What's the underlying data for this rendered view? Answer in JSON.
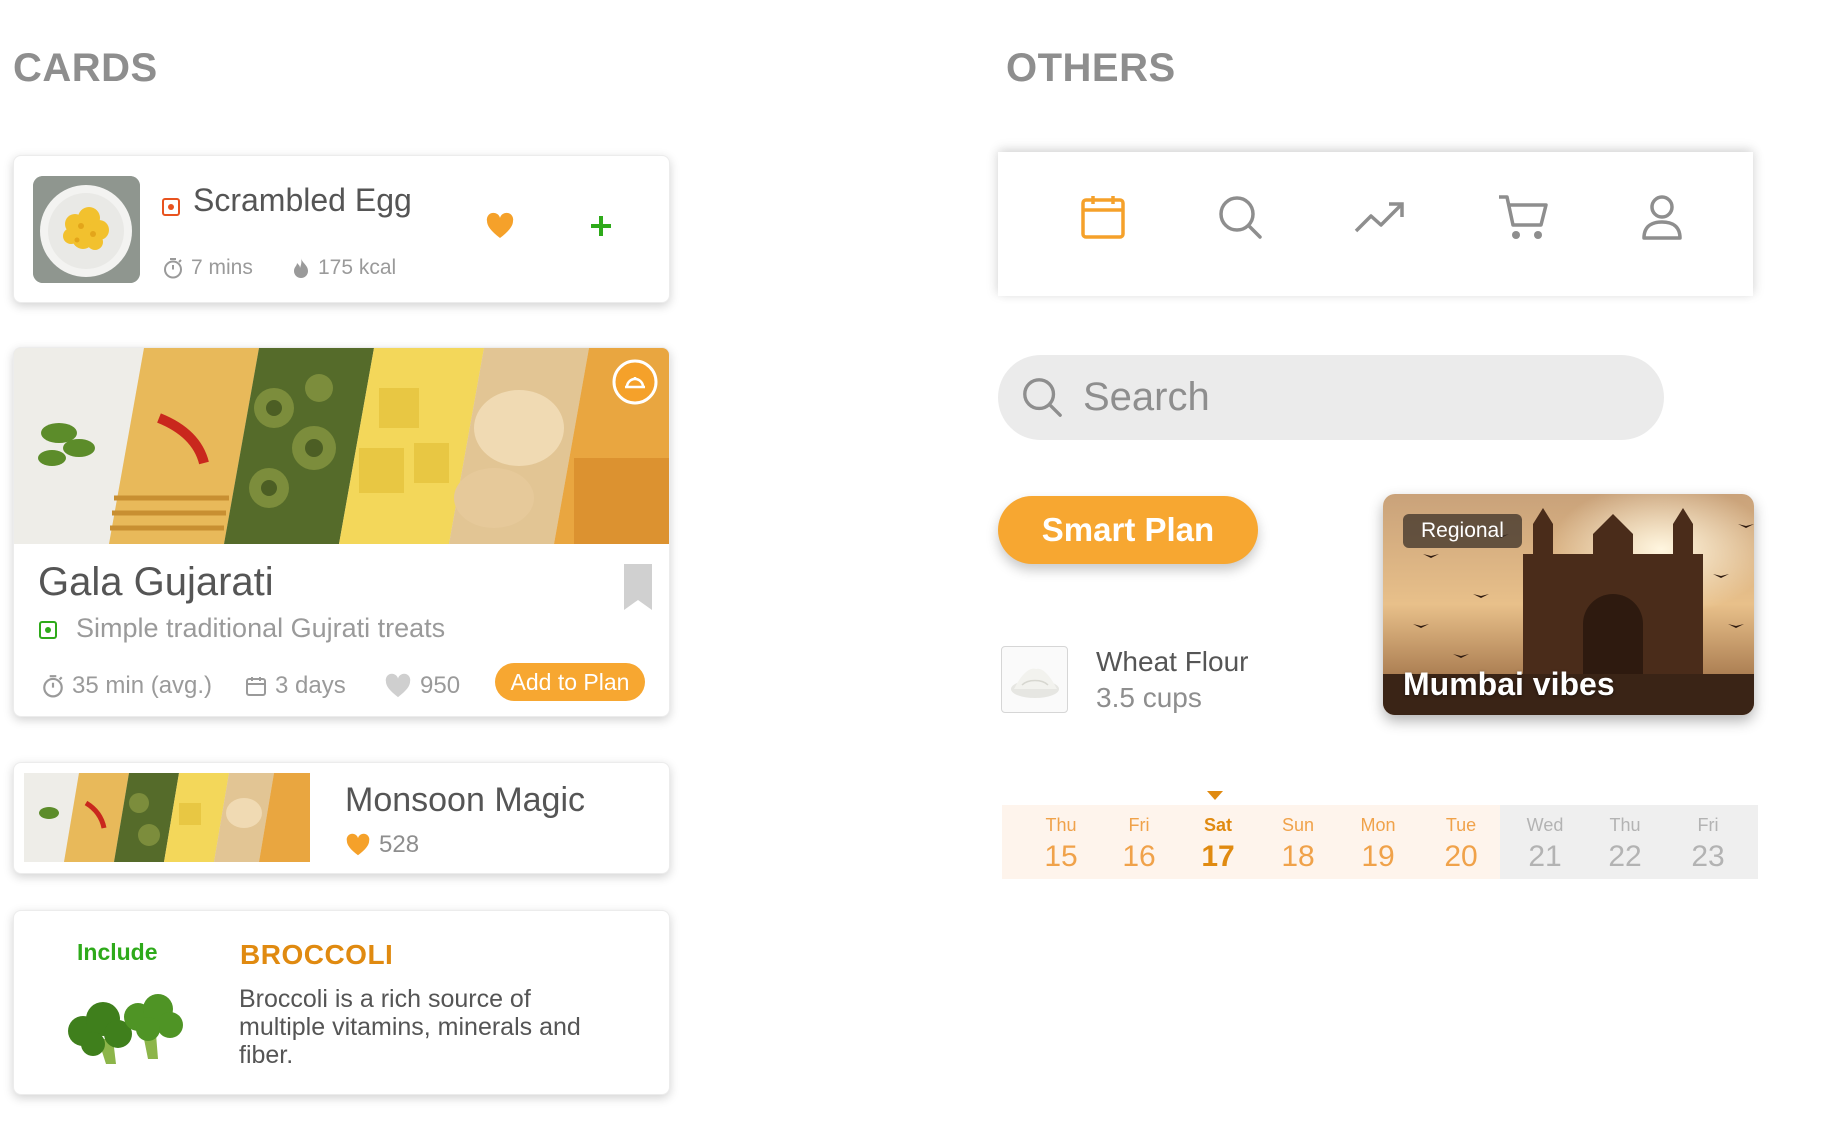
{
  "sections": {
    "cards_title": "CARDS",
    "others_title": "OTHERS"
  },
  "egg_card": {
    "title": "Scrambled Egg",
    "time": "7 mins",
    "calories": "175 kcal",
    "veg_mark_color": "#e8531f",
    "icons": {
      "favorite": "heart-icon",
      "add": "plus-icon",
      "time": "stopwatch-icon",
      "calories": "flame-icon"
    }
  },
  "gala_card": {
    "title": "Gala Gujarati",
    "subtitle": "Simple traditional Gujrati treats",
    "avg_time": "35 min (avg.)",
    "duration": "3 days",
    "likes": "950",
    "cta": "Add to Plan",
    "veg_mark_color": "#2eaa1a",
    "icons": {
      "bookmark": "bookmark-icon",
      "badge": "dish-icon"
    }
  },
  "monsoon_card": {
    "title": "Monsoon Magic",
    "likes": "528"
  },
  "broccoli_card": {
    "label": "Include",
    "title": "BROCCOLI",
    "description": "Broccoli is a rich source of multiple vitamins, minerals and fiber."
  },
  "tabbar": {
    "active_color": "#f5a12a",
    "items": [
      {
        "name": "calendar-icon",
        "active": true
      },
      {
        "name": "search-icon",
        "active": false
      },
      {
        "name": "trending-icon",
        "active": false
      },
      {
        "name": "cart-icon",
        "active": false
      },
      {
        "name": "profile-icon",
        "active": false
      }
    ]
  },
  "search": {
    "placeholder": "Search"
  },
  "smart_plan": {
    "label": "Smart Plan"
  },
  "ingredient": {
    "name": "Wheat Flour",
    "quantity": "3.5 cups"
  },
  "regional_card": {
    "tag": "Regional",
    "title": "Mumbai vibes"
  },
  "date_strip": {
    "selected": "17",
    "days": [
      {
        "name": "Thu",
        "date": "15",
        "state": "future"
      },
      {
        "name": "Fri",
        "date": "16",
        "state": "future"
      },
      {
        "name": "Sat",
        "date": "17",
        "state": "active"
      },
      {
        "name": "Sun",
        "date": "18",
        "state": "future"
      },
      {
        "name": "Mon",
        "date": "19",
        "state": "future"
      },
      {
        "name": "Tue",
        "date": "20",
        "state": "future"
      },
      {
        "name": "Wed",
        "date": "21",
        "state": "past"
      },
      {
        "name": "Thu",
        "date": "22",
        "state": "past"
      },
      {
        "name": "Fri",
        "date": "23",
        "state": "past"
      }
    ]
  },
  "colors": {
    "accent": "#f7a731",
    "text": "#555555",
    "muted": "#9a9a9a",
    "veg_green": "#2eaa1a"
  }
}
